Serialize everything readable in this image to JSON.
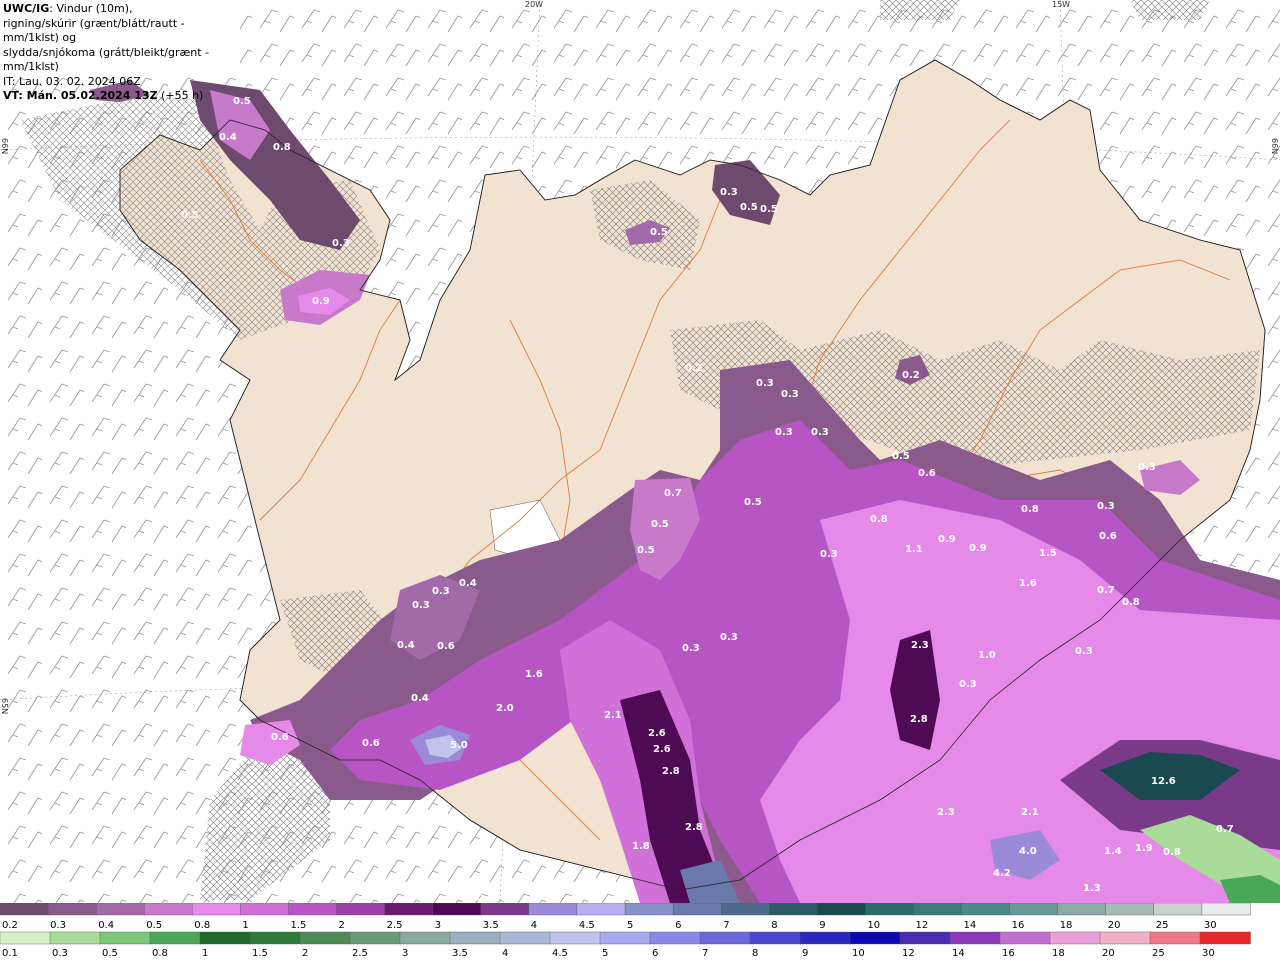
{
  "header": {
    "model_tag": "UWC/IG",
    "line1": ": Vindur (10m),",
    "line2": "rigning/skúrir (grænt/blátt/rautt - mm/1klst) og",
    "line3": "slydda/snjókoma (grátt/bleikt/grænt - mm/1klst)",
    "it_line": "IT: Lau. 03. 02. 2024 06Z",
    "vt_bold": "VT: Mán. 05.02.2024 13Z",
    "vt_rest": " (+55 h)"
  },
  "axes": {
    "lon_labels": [
      "20W",
      "15W"
    ],
    "lat_labels": [
      "66N",
      "65N",
      "66N"
    ]
  },
  "precip_labels": [
    "0.5",
    "0.4",
    "0.8",
    "0.5",
    "0.3",
    "0.9",
    "0.3",
    "0.5",
    "0.5",
    "0.5",
    "0.3",
    "0.2",
    "0.3",
    "0.2",
    "0.3",
    "0.3",
    "0.5",
    "0.6",
    "0.7",
    "0.5",
    "0.5",
    "0.5",
    "0.8",
    "0.3",
    "0.3",
    "0.6",
    "0.9",
    "0.9",
    "0.8",
    "0.3",
    "1.1",
    "1.5",
    "1.6",
    "0.7",
    "0.8",
    "0.3",
    "0.4",
    "0.3",
    "0.3",
    "0.4",
    "0.6",
    "1.6",
    "0.4",
    "2.0",
    "2.1",
    "2.6",
    "2.6",
    "2.8",
    "0.6",
    "0.6",
    "5.0",
    "2.3",
    "2.8",
    "1.0",
    "0.3",
    "2.3",
    "2.1",
    "4.0",
    "4.2",
    "1.8",
    "2.8",
    "2.0",
    "12.6",
    "1.4",
    "1.9",
    "0.8",
    "0.7",
    "1.3",
    "0.3",
    "0.3"
  ],
  "legend_snow": {
    "ticks": [
      "0.2",
      "0.3",
      "0.4",
      "0.5",
      "0.8",
      "1",
      "1.5",
      "2",
      "2.5",
      "3",
      "3.5",
      "4",
      "4.5",
      "5",
      "6",
      "7",
      "8",
      "9",
      "10",
      "12",
      "14",
      "16",
      "18",
      "20",
      "25",
      "30"
    ],
    "colors": [
      "#6e4a6e",
      "#8a5a8c",
      "#a36aa8",
      "#c77ac9",
      "#e58ae8",
      "#d070d8",
      "#b855c4",
      "#9a3fa8",
      "#6a1a6e",
      "#4e0a52",
      "#7a3a8a",
      "#9a8ad8",
      "#b8b0ee",
      "#8890c8",
      "#6a7aaa",
      "#4e6a8a",
      "#2e5a6a",
      "#1a4a50",
      "#2a6a6a",
      "#3a7a78",
      "#4a8a88",
      "#6a9a98",
      "#8aaaa8",
      "#a8bab8",
      "#c8d0d0",
      "#e8eaea"
    ]
  },
  "legend_rain": {
    "ticks": [
      "0.1",
      "0.3",
      "0.5",
      "0.8",
      "1",
      "1.5",
      "2",
      "2.5",
      "3",
      "3.5",
      "4",
      "4.5",
      "5",
      "6",
      "7",
      "8",
      "9",
      "10",
      "12",
      "14",
      "16",
      "18",
      "20",
      "25",
      "30"
    ],
    "colors": [
      "#d8f0c8",
      "#a8dc98",
      "#7ac878",
      "#4aa858",
      "#1e6a2a",
      "#2e7a38",
      "#4e8a58",
      "#6a9a78",
      "#8aaaa0",
      "#9ab0c0",
      "#aab8d8",
      "#c0c4ec",
      "#a8a8f0",
      "#8a88e8",
      "#6a68dc",
      "#4a48d0",
      "#2a28c0",
      "#0a0ab0",
      "#4a2ab0",
      "#8a3ab8",
      "#c070d0",
      "#e8a0d8",
      "#f0b0c8",
      "#f07888",
      "#e82828"
    ]
  }
}
